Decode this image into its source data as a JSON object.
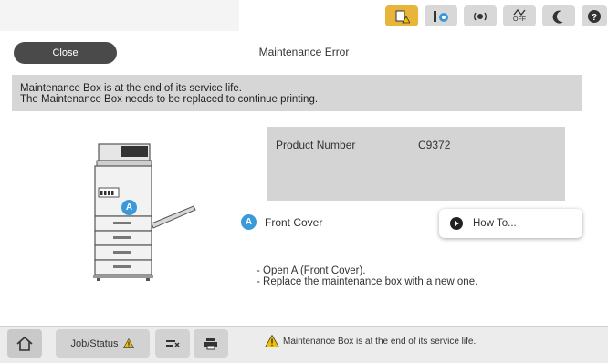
{
  "topbar": {
    "icons": [
      "paper-warning-icon",
      "ink-icon",
      "wifi-icon",
      "wifi-direct-off-icon",
      "sleep-icon",
      "help-icon"
    ],
    "wifi_direct_label": "OFF"
  },
  "header": {
    "close_label": "Close",
    "title": "Maintenance Error"
  },
  "message": {
    "line1": "Maintenance Box is at the end of its service life.",
    "line2": "The Maintenance Box needs to be replaced to continue printing."
  },
  "product": {
    "label": "Product Number",
    "value": "C9372"
  },
  "illustration": {
    "badge": "A"
  },
  "front_cover": {
    "badge": "A",
    "label": "Front Cover"
  },
  "howto": {
    "label": "How To..."
  },
  "instructions": {
    "line1": "- Open A (Front Cover).",
    "line2": "- Replace the maintenance box with a new one."
  },
  "bottombar": {
    "job_status_label": "Job/Status",
    "status_message": "Maintenance Box is at the end of its service life."
  },
  "colors": {
    "accent_blue": "#3a9ad9",
    "warning_yellow": "#e8b53a",
    "close_button": "#4a4a4a"
  }
}
